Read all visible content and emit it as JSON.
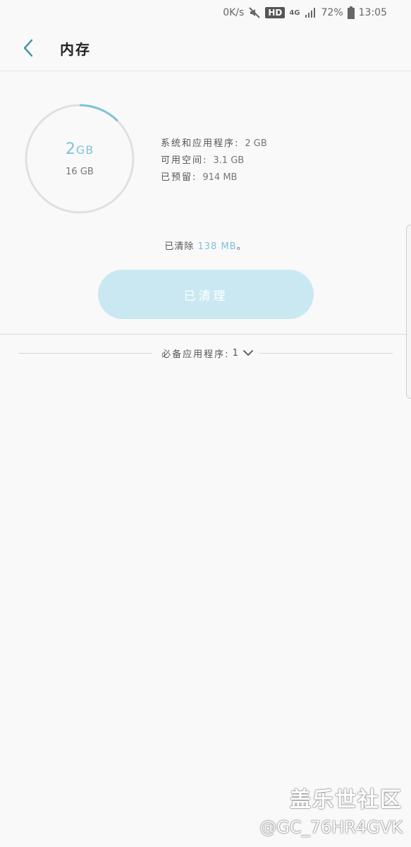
{
  "status_bar": {
    "net_speed": "0K/s",
    "hd": "HD",
    "network": "4G",
    "battery": "72%",
    "time": "13:05"
  },
  "header": {
    "title": "内存"
  },
  "memory": {
    "used": "2",
    "used_unit": "GB",
    "total": "16 GB",
    "used_fraction": 0.125,
    "details": [
      {
        "label": "系统和应用程序:",
        "value": "2 GB"
      },
      {
        "label": "可用空间:",
        "value": "3.1 GB"
      },
      {
        "label": "已预留:",
        "value": "914 MB"
      }
    ]
  },
  "cleared": {
    "prefix": "已清除",
    "amount": "138 MB",
    "suffix": "。"
  },
  "clean_button": {
    "label": "已清理"
  },
  "required_apps": {
    "label": "必备应用程序:",
    "count": "1"
  },
  "watermark": {
    "name": "盖乐世社区",
    "user": "@GC_76HR4GVK"
  },
  "colors": {
    "accent": "#7ec3d8",
    "button_bg": "#cae8f2"
  }
}
